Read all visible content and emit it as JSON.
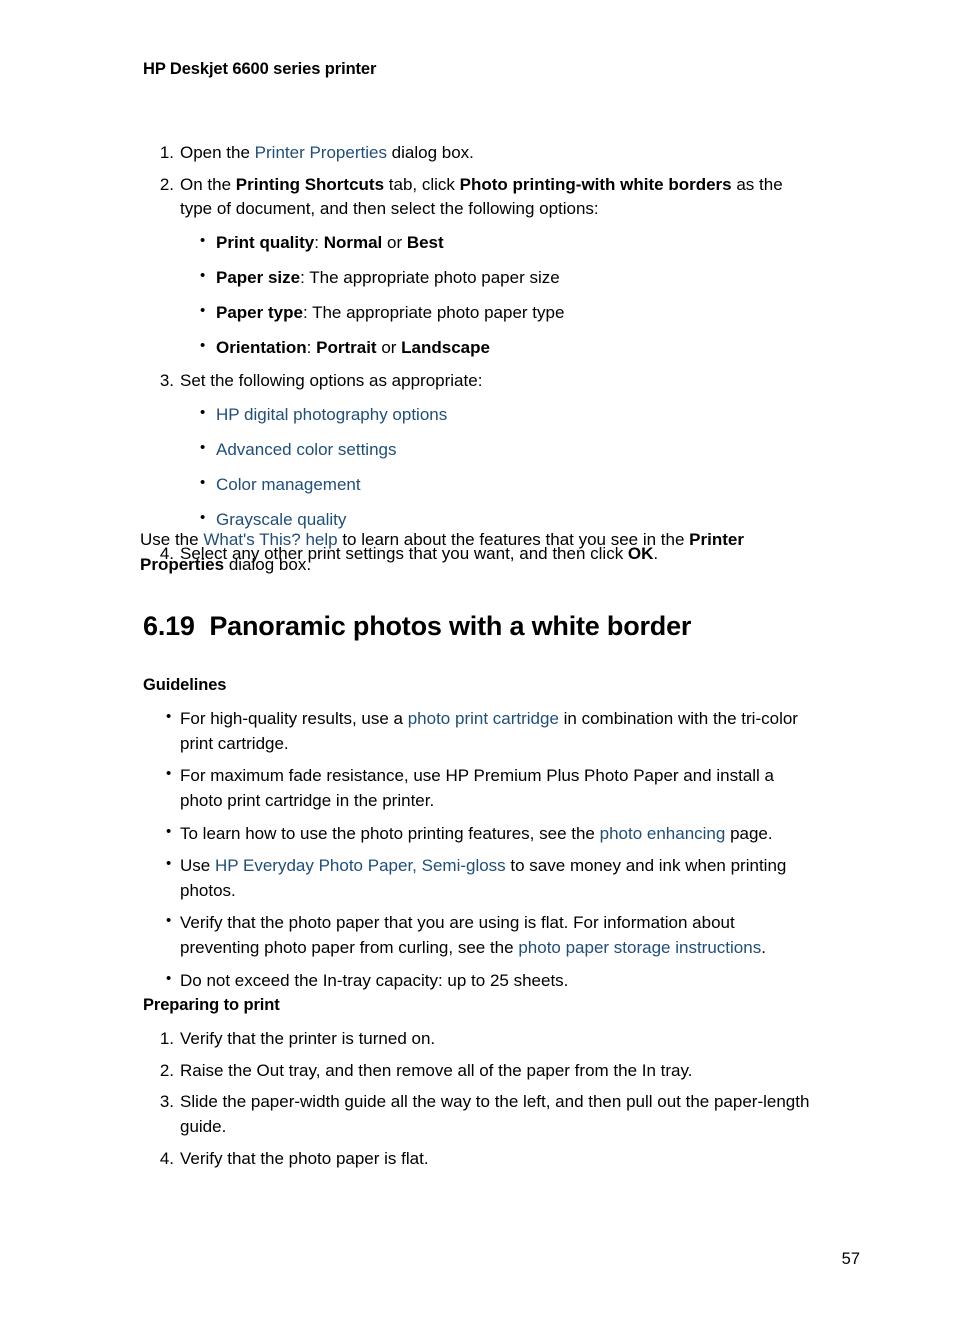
{
  "document": {
    "running_header": "HP Deskjet 6600 series printer",
    "page_number": "57",
    "link_color": "#1F4E79",
    "text_color": "#000000",
    "background_color": "#FFFFFF"
  },
  "procedure": {
    "steps": [
      {
        "number": "1.",
        "parts": [
          {
            "text": "Open the ",
            "style": "normal"
          },
          {
            "text": "Printer Properties",
            "style": "link"
          },
          {
            "text": " dialog box.",
            "style": "normal"
          }
        ]
      },
      {
        "number": "2.",
        "parts": [
          {
            "text": "On the ",
            "style": "normal"
          },
          {
            "text": "Printing Shortcuts",
            "style": "bold"
          },
          {
            "text": " tab, click ",
            "style": "normal"
          },
          {
            "text": "Photo printing-with white borders",
            "style": "bold"
          },
          {
            "text": " as the type of document, and then select the following options:",
            "style": "normal"
          }
        ],
        "sub_bullets": [
          {
            "bullet": "•",
            "parts": [
              {
                "text": "Print quality",
                "style": "bold"
              },
              {
                "text": ": ",
                "style": "normal"
              },
              {
                "text": "Normal",
                "style": "bold"
              },
              {
                "text": " or ",
                "style": "normal"
              },
              {
                "text": "Best",
                "style": "bold"
              }
            ]
          },
          {
            "bullet": "•",
            "parts": [
              {
                "text": "Paper size",
                "style": "bold"
              },
              {
                "text": ": The appropriate photo paper size",
                "style": "normal"
              }
            ]
          },
          {
            "bullet": "•",
            "parts": [
              {
                "text": "Paper type",
                "style": "bold"
              },
              {
                "text": ": The appropriate photo paper type",
                "style": "normal"
              }
            ]
          },
          {
            "bullet": "•",
            "parts": [
              {
                "text": "Orientation",
                "style": "bold"
              },
              {
                "text": ": ",
                "style": "normal"
              },
              {
                "text": "Portrait",
                "style": "bold"
              },
              {
                "text": " or ",
                "style": "normal"
              },
              {
                "text": "Landscape",
                "style": "bold"
              }
            ]
          }
        ]
      },
      {
        "number": "3.",
        "parts": [
          {
            "text": "Set the following options as appropriate:",
            "style": "normal"
          }
        ],
        "sub_bullets": [
          {
            "bullet": "•",
            "parts": [
              {
                "text": "HP digital photography options",
                "style": "link"
              }
            ]
          },
          {
            "bullet": "•",
            "parts": [
              {
                "text": "Advanced color settings",
                "style": "link"
              }
            ]
          },
          {
            "bullet": "•",
            "parts": [
              {
                "text": "Color management",
                "style": "link"
              }
            ]
          },
          {
            "bullet": "•",
            "parts": [
              {
                "text": "Grayscale quality",
                "style": "link"
              }
            ]
          }
        ]
      },
      {
        "number": "4.",
        "parts": [
          {
            "text": "Select any other print settings that you want, and then click ",
            "style": "normal"
          },
          {
            "text": "OK",
            "style": "bold"
          },
          {
            "text": ".",
            "style": "normal"
          }
        ]
      }
    ]
  },
  "whats_this_paragraph": {
    "parts": [
      {
        "text": "Use the ",
        "style": "normal"
      },
      {
        "text": "What's This? help",
        "style": "link"
      },
      {
        "text": " to learn about the features that you see in the ",
        "style": "normal"
      },
      {
        "text": "Printer Properties",
        "style": "bold"
      },
      {
        "text": " dialog box.",
        "style": "normal"
      }
    ]
  },
  "section": {
    "number": "6.19",
    "title": "Panoramic photos with a white border",
    "heading_full": "6.19  Panoramic photos with a white border"
  },
  "guidelines": {
    "heading": "Guidelines",
    "items": [
      {
        "bullet": "•",
        "parts": [
          {
            "text": "For high-quality results, use a ",
            "style": "normal"
          },
          {
            "text": "photo print cartridge",
            "style": "link"
          },
          {
            "text": " in combination with the tri-color print cartridge.",
            "style": "normal"
          }
        ]
      },
      {
        "bullet": "•",
        "parts": [
          {
            "text": "For maximum fade resistance, use HP Premium Plus Photo Paper and install a photo print cartridge in the printer.",
            "style": "normal"
          }
        ]
      },
      {
        "bullet": "•",
        "parts": [
          {
            "text": "To learn how to use the photo printing features, see the ",
            "style": "normal"
          },
          {
            "text": "photo enhancing",
            "style": "link"
          },
          {
            "text": " page.",
            "style": "normal"
          }
        ]
      },
      {
        "bullet": "•",
        "parts": [
          {
            "text": "Use ",
            "style": "normal"
          },
          {
            "text": "HP Everyday Photo Paper, Semi-gloss",
            "style": "link"
          },
          {
            "text": " to save money and ink when printing photos.",
            "style": "normal"
          }
        ]
      },
      {
        "bullet": "•",
        "parts": [
          {
            "text": "Verify that the photo paper that you are using is flat. For information about preventing photo paper from curling, see the ",
            "style": "normal"
          },
          {
            "text": "photo paper storage instructions",
            "style": "link"
          },
          {
            "text": ".",
            "style": "normal"
          }
        ]
      },
      {
        "bullet": "•",
        "parts": [
          {
            "text": "Do not exceed the In-tray capacity: up to 25 sheets.",
            "style": "normal"
          }
        ]
      }
    ]
  },
  "preparing_to_print": {
    "heading": "Preparing to print",
    "steps": [
      {
        "number": "1.",
        "parts": [
          {
            "text": "Verify that the printer is turned on.",
            "style": "normal"
          }
        ]
      },
      {
        "number": "2.",
        "parts": [
          {
            "text": "Raise the Out tray, and then remove all of the paper from the In tray.",
            "style": "normal"
          }
        ]
      },
      {
        "number": "3.",
        "parts": [
          {
            "text": "Slide the paper-width guide all the way to the left, and then pull out the paper-length guide.",
            "style": "normal"
          }
        ]
      },
      {
        "number": "4.",
        "parts": [
          {
            "text": "Verify that the photo paper is flat.",
            "style": "normal"
          }
        ]
      }
    ]
  }
}
